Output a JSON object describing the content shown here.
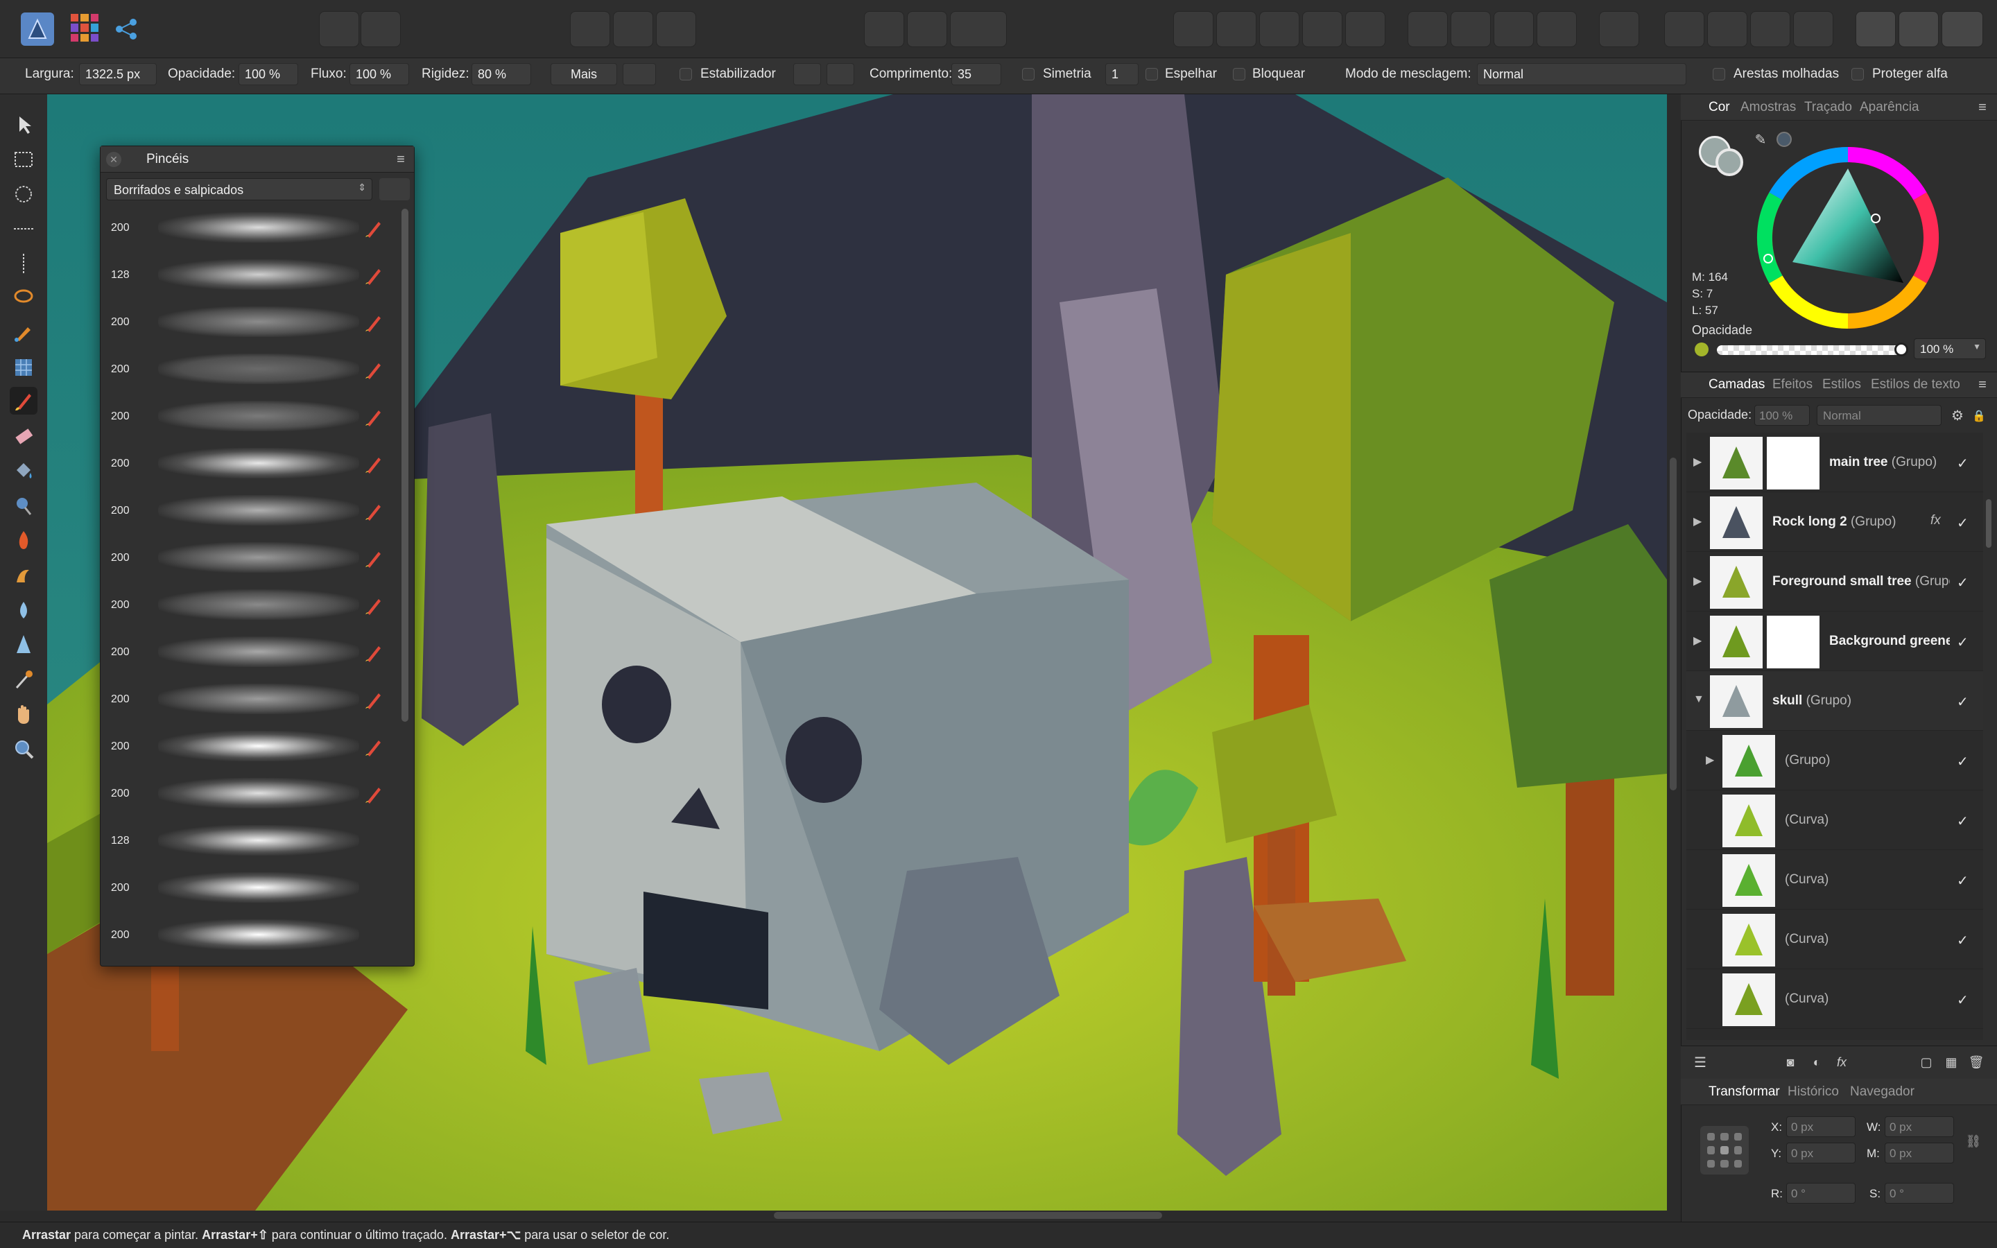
{
  "toolbar": {
    "context": {
      "largura_label": "Largura:",
      "largura_value": "1322.5 px",
      "opacidade_label": "Opacidade:",
      "opacidade_value": "100 %",
      "fluxo_label": "Fluxo:",
      "fluxo_value": "100 %",
      "rigidez_label": "Rigidez:",
      "rigidez_value": "80 %",
      "mais_label": "Mais",
      "estabilizador_label": "Estabilizador",
      "comprimento_label": "Comprimento:",
      "comprimento_value": "35",
      "simetria_label": "Simetria",
      "simetria_value": "1",
      "espelhar_label": "Espelhar",
      "bloquear_label": "Bloquear",
      "modo_label": "Modo de mesclagem:",
      "modo_value": "Normal",
      "arestas_label": "Arestas molhadas",
      "proteger_label": "Proteger alfa"
    }
  },
  "brushes_panel": {
    "title": "Pincéis",
    "category": "Borrifados e salpicados",
    "brushes": [
      {
        "size": "200"
      },
      {
        "size": "128"
      },
      {
        "size": "200"
      },
      {
        "size": "200"
      },
      {
        "size": "200"
      },
      {
        "size": "200"
      },
      {
        "size": "200"
      },
      {
        "size": "200"
      },
      {
        "size": "200"
      },
      {
        "size": "200"
      },
      {
        "size": "200"
      },
      {
        "size": "200"
      },
      {
        "size": "200"
      },
      {
        "size": "128"
      },
      {
        "size": "200"
      },
      {
        "size": "200"
      }
    ]
  },
  "color_panel": {
    "tabs": [
      "Cor",
      "Amostras",
      "Traçado",
      "Aparência"
    ],
    "h_label": "M: 164",
    "s_label": "S: 7",
    "l_label": "L: 57",
    "opacity_label": "Opacidade",
    "opacity_value": "100 %",
    "colors": {
      "fill": "#9aa8a6",
      "accent_dot": "#a3b52a"
    }
  },
  "layers_panel": {
    "tabs": [
      "Camadas",
      "Efeitos",
      "Estilos",
      "Estilos de texto"
    ],
    "opacity_label": "Opacidade:",
    "opacity_value": "100 %",
    "blend_value": "Normal",
    "layers": [
      {
        "name": "main tree",
        "type": "(Grupo)"
      },
      {
        "name": "Rock long 2",
        "type": "(Grupo)"
      },
      {
        "name": "Foreground small tree",
        "type": "(Grupo)"
      },
      {
        "name": "Background greenery",
        "type": ""
      },
      {
        "name": "skull",
        "type": "(Grupo)"
      },
      {
        "name": "",
        "type": "(Grupo)"
      },
      {
        "name": "",
        "type": "(Curva)"
      },
      {
        "name": "",
        "type": "(Curva)"
      },
      {
        "name": "",
        "type": "(Curva)"
      },
      {
        "name": "",
        "type": "(Curva)"
      }
    ]
  },
  "transform_panel": {
    "tabs": [
      "Transformar",
      "Histórico",
      "Navegador"
    ],
    "x_label": "X:",
    "x_value": "0 px",
    "y_label": "Y:",
    "y_value": "0 px",
    "w_label": "W:",
    "w_value": "0 px",
    "h_label": "M:",
    "h_value": "0 px",
    "r_label": "R:",
    "r_value": "0 °",
    "s_label": "S:",
    "s_value": "0 °"
  },
  "status_bar": {
    "part1_bold": "Arrastar",
    "part1": " para começar a pintar. ",
    "part2_bold": "Arrastar+⇧",
    "part2": " para continuar o último traçado. ",
    "part3_bold": "Arrastar+⌥",
    "part3": " para usar o seletor de cor."
  }
}
